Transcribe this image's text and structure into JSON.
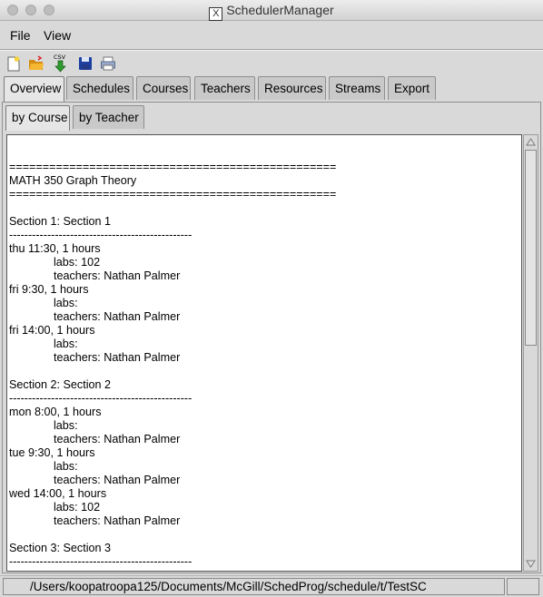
{
  "window": {
    "title": "SchedulerManager"
  },
  "menubar": {
    "file": "File",
    "view": "View"
  },
  "toolbar": {
    "new_icon": "new-file-icon",
    "open_icon": "open-folder-icon",
    "csv_label": "CSV",
    "save_icon": "save-disk-icon",
    "print_icon": "print-icon"
  },
  "tabs": [
    {
      "label": "Overview"
    },
    {
      "label": "Schedules"
    },
    {
      "label": "Courses"
    },
    {
      "label": "Teachers"
    },
    {
      "label": "Resources"
    },
    {
      "label": "Streams"
    },
    {
      "label": "Export"
    }
  ],
  "subtabs": [
    {
      "label": "by Course"
    },
    {
      "label": "by Teacher"
    }
  ],
  "overview_text": "=================================================\nMATH 350 Graph Theory\n=================================================\n\nSection 1: Section 1\n------------------------------------------------\nthu 11:30, 1 hours\n              labs: 102\n              teachers: Nathan Palmer\nfri 9:30, 1 hours\n              labs:\n              teachers: Nathan Palmer\nfri 14:00, 1 hours\n              labs:\n              teachers: Nathan Palmer\n\nSection 2: Section 2\n------------------------------------------------\nmon 8:00, 1 hours\n              labs:\n              teachers: Nathan Palmer\ntue 9:30, 1 hours\n              labs:\n              teachers: Nathan Palmer\nwed 14:00, 1 hours\n              labs: 102\n              teachers: Nathan Palmer\n\nSection 3: Section 3\n------------------------------------------------",
  "status": {
    "path": "/Users/koopatroopa125/Documents/McGill/SchedProg/schedule/t/TestSC"
  },
  "colors": {
    "window_bg": "#d9d9d9",
    "text_bg": "#ffffff",
    "save_icon": "#1c3fa0",
    "folder_icon": "#f0a91f"
  }
}
